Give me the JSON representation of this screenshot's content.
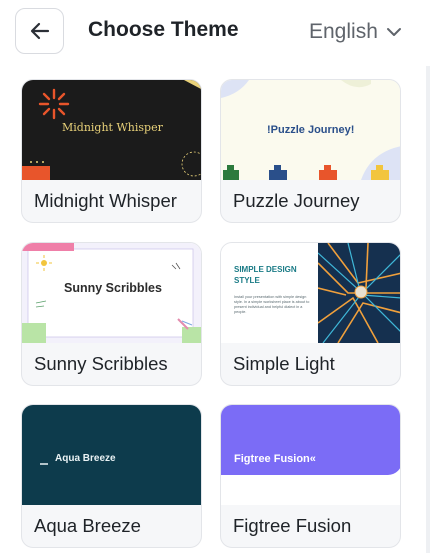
{
  "header": {
    "title": "Choose Theme",
    "language": "English",
    "back_icon": "arrow-left-icon",
    "dropdown_icon": "chevron-down-icon"
  },
  "themes": [
    {
      "name": "Midnight Whisper",
      "preview_title": "Midnight Whisper",
      "accent": "#e9d27a",
      "background": "#1b1b1b"
    },
    {
      "name": "Puzzle Journey",
      "preview_title": "!Puzzle Journey!",
      "accent": "#2a4f8a",
      "background": "#fbfaee"
    },
    {
      "name": "Sunny Scribbles",
      "preview_title": "Sunny Scribbles",
      "accent": "#f2c53d",
      "background": "#ffffff"
    },
    {
      "name": "Simple Light",
      "preview_title": "SIMPLE DESIGN STYLE",
      "preview_body": "Install your presentation with simple design style. In a simple worksheet place is about to present individual and helpful dialect in a people.",
      "accent": "#1a7b86",
      "background": "#ffffff"
    },
    {
      "name": "Aqua Breeze",
      "preview_title": "Aqua Breeze",
      "accent": "#e9f2f4",
      "background": "#0d3b4c"
    },
    {
      "name": "Figtree Fusion",
      "preview_title": "Figtree Fusion«",
      "accent": "#7b6cf6",
      "background": "#ffffff"
    }
  ]
}
